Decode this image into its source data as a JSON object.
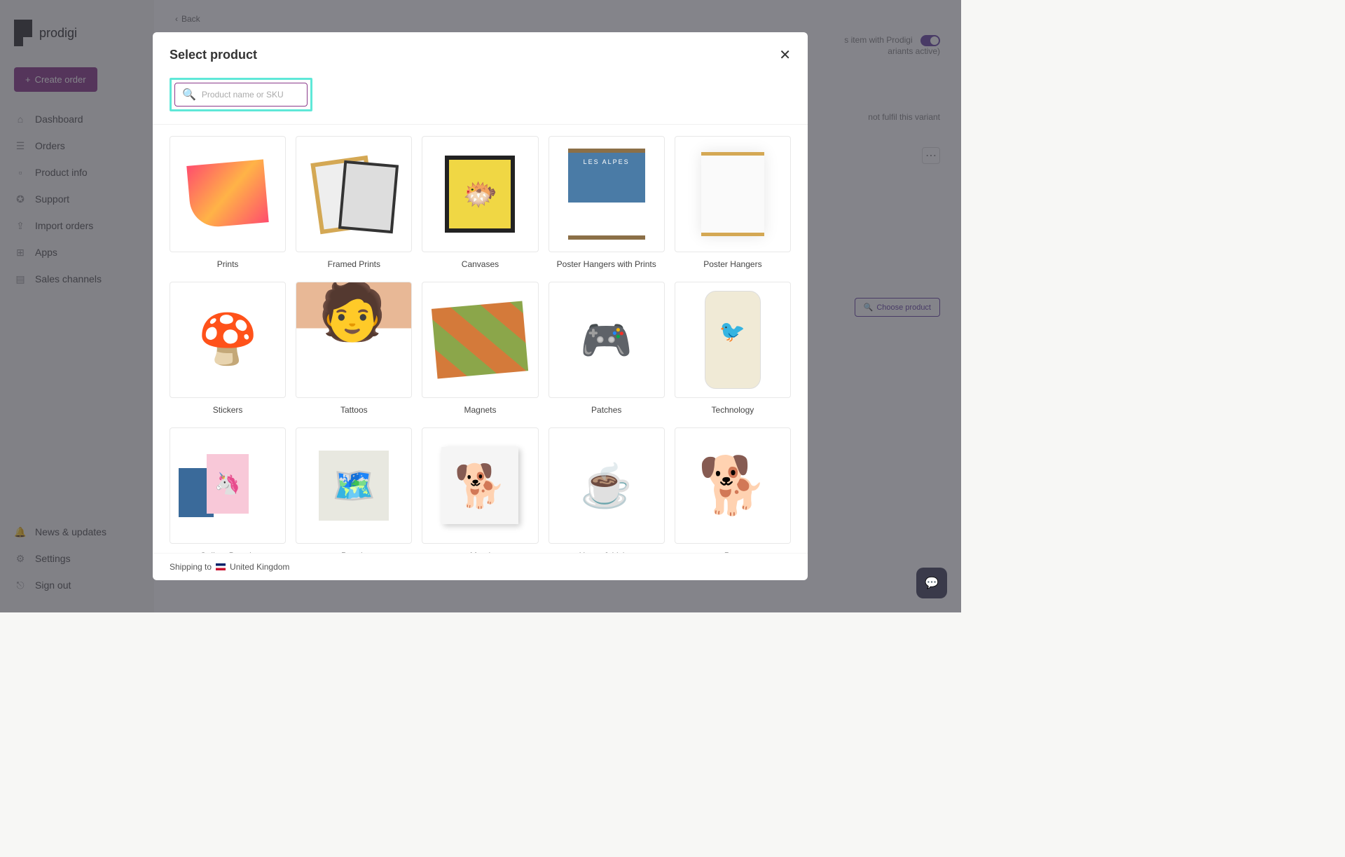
{
  "brand": "prodigi",
  "create_button": "Create order",
  "nav": {
    "dashboard": "Dashboard",
    "orders": "Orders",
    "product_info": "Product info",
    "support": "Support",
    "import_orders": "Import orders",
    "apps": "Apps",
    "sales_channels": "Sales channels",
    "news": "News & updates",
    "settings": "Settings",
    "signout": "Sign out"
  },
  "back": "Back",
  "header_right": {
    "line1": "s item with Prodigi",
    "line2": "ariants active)"
  },
  "variant_note": "not fulfil this variant",
  "choose_product": "Choose product",
  "modal": {
    "title": "Select product",
    "search_placeholder": "Product name or SKU",
    "shipping_prefix": "Shipping to",
    "shipping_country": "United Kingdom"
  },
  "categories": [
    {
      "label": "Prints",
      "imgclass": "img-prints"
    },
    {
      "label": "Framed Prints",
      "imgclass": "img-framed"
    },
    {
      "label": "Canvases",
      "imgclass": "img-canvas"
    },
    {
      "label": "Poster Hangers with Prints",
      "imgclass": "img-posterh"
    },
    {
      "label": "Poster Hangers",
      "imgclass": "img-hanger"
    },
    {
      "label": "Stickers",
      "imgclass": "img-sticker",
      "emoji": "🍄"
    },
    {
      "label": "Tattoos",
      "imgclass": "img-tattoo"
    },
    {
      "label": "Magnets",
      "imgclass": "img-magnets"
    },
    {
      "label": "Patches",
      "imgclass": "img-patches",
      "emoji": "🎮"
    },
    {
      "label": "Technology",
      "imgclass": "img-tech"
    },
    {
      "label": "Gallery Boards",
      "imgclass": "img-gallery"
    },
    {
      "label": "Panels",
      "imgclass": "img-panels",
      "emoji": "🗺️"
    },
    {
      "label": "Metal",
      "imgclass": "img-metal",
      "emoji": "🐕"
    },
    {
      "label": "Home & Living",
      "imgclass": "img-home",
      "emoji": "☕"
    },
    {
      "label": "Pets",
      "imgclass": "img-pets",
      "emoji": "🐕"
    },
    {
      "label": "",
      "imgclass": "img-more"
    },
    {
      "label": "",
      "imgclass": "img-more"
    },
    {
      "label": "",
      "imgclass": "img-apparel"
    },
    {
      "label": "",
      "imgclass": "img-more"
    },
    {
      "label": "",
      "imgclass": "img-more"
    }
  ]
}
